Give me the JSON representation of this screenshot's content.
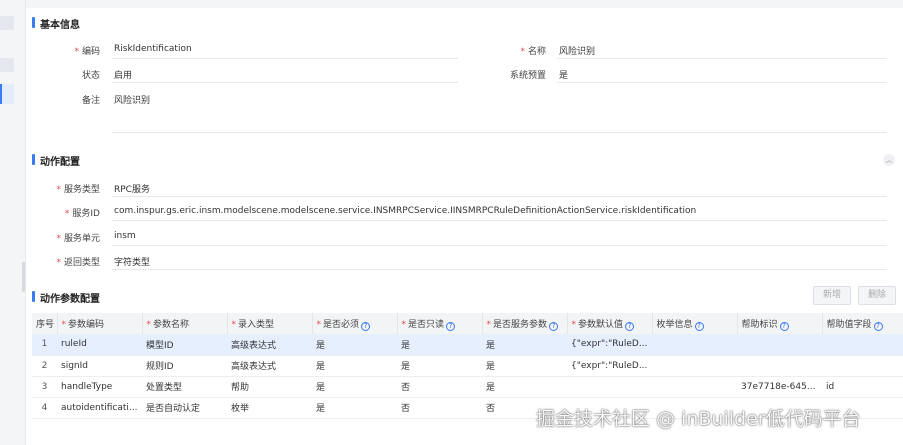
{
  "basic_info": {
    "title": "基本信息",
    "code_label": "编码",
    "code_value": "RiskIdentification",
    "name_label": "名称",
    "name_value": "风险识别",
    "status_label": "状态",
    "status_value": "启用",
    "system_preset_label": "系统预置",
    "system_preset_value": "是",
    "remark_label": "备注",
    "remark_value": "风险识别"
  },
  "action_config": {
    "title": "动作配置",
    "collapse_icon": "chevron-up-icon",
    "service_type_label": "服务类型",
    "service_type_value": "RPC服务",
    "service_id_label": "服务ID",
    "service_id_value": "com.inspur.gs.eric.insm.modelscene.modelscene.service.INSMRPCService.IINSMRPCRuleDefinitionActionService.riskIdentification",
    "service_unit_label": "服务单元",
    "service_unit_value": "insm",
    "return_type_label": "返回类型",
    "return_type_value": "字符类型"
  },
  "params": {
    "title": "动作参数配置",
    "add_label": "新增",
    "delete_label": "删除",
    "columns": {
      "seq": "序号",
      "code": "参数编码",
      "name": "参数名称",
      "input_type": "录入类型",
      "required": "是否必须",
      "readonly": "是否只读",
      "service_param": "是否服务参数",
      "default": "参数默认值",
      "enum": "枚举信息",
      "help_id": "帮助标识",
      "help_field": "帮助值字段"
    },
    "rows": [
      {
        "seq": "1",
        "code": "ruleId",
        "name": "模型ID",
        "input_type": "高级表达式",
        "required": "是",
        "readonly": "是",
        "service_param": "是",
        "default": "{\"expr\":\"RuleD...",
        "enum": "",
        "help_id": "",
        "help_field": ""
      },
      {
        "seq": "2",
        "code": "signId",
        "name": "规则ID",
        "input_type": "高级表达式",
        "required": "是",
        "readonly": "是",
        "service_param": "是",
        "default": "{\"expr\":\"RuleD...",
        "enum": "",
        "help_id": "",
        "help_field": ""
      },
      {
        "seq": "3",
        "code": "handleType",
        "name": "处置类型",
        "input_type": "帮助",
        "required": "是",
        "readonly": "否",
        "service_param": "是",
        "default": "",
        "enum": "",
        "help_id": "37e7718e-645...",
        "help_field": "id"
      },
      {
        "seq": "4",
        "code": "autoidentificati...",
        "name": "是否自动认定",
        "input_type": "枚举",
        "required": "是",
        "readonly": "否",
        "service_param": "否",
        "default": "",
        "enum": "",
        "help_id": "",
        "help_field": ""
      }
    ]
  },
  "watermark": "掘金技术社区 @ inBuilder低代码平台",
  "colors": {
    "accent": "#3a7af2",
    "required": "#e5484d",
    "selected_row": "#e6effe"
  }
}
